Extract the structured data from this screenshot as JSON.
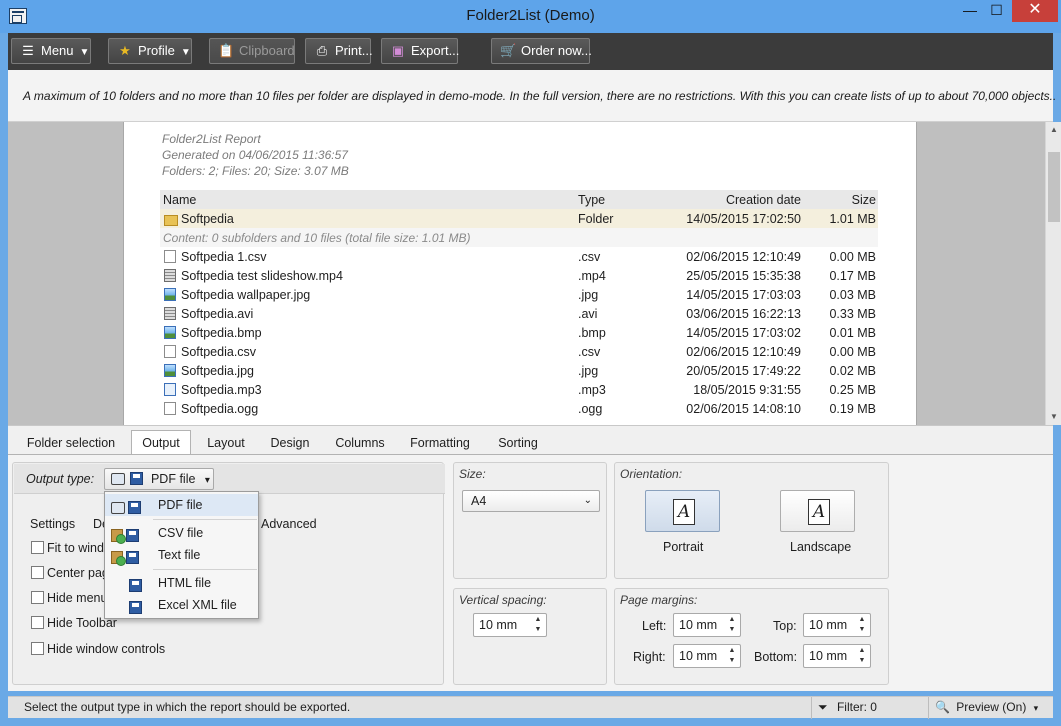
{
  "window": {
    "title": "Folder2List (Demo)",
    "minimize": "—",
    "maximize": "☐",
    "close": "✕"
  },
  "toolbar": {
    "menu": "Menu",
    "profile": "Profile",
    "clipboard": "Clipboard",
    "print": "Print...",
    "export": "Export...",
    "order": "Order now..."
  },
  "notice": "A maximum of 10 folders and no more than 10 files per folder are displayed in demo-mode. In the full version, there are no restrictions. With this you can create lists of up to about 70,000 objects..",
  "report": {
    "title": "Folder2List Report",
    "generated": "Generated on 04/06/2015 11:36:57",
    "summary": "Folders: 2;  Files: 20;  Size: 3.07 MB",
    "headers": {
      "name": "Name",
      "type": "Type",
      "date": "Creation date",
      "size": "Size"
    },
    "folder": {
      "icon": "folder-icon",
      "name": "Softpedia",
      "type": "Folder",
      "date": "14/05/2015 17:02:50",
      "size": "1.01 MB"
    },
    "folder_content": "Content: 0 subfolders and 10 files (total file size: 1.01 MB)",
    "files": [
      {
        "icon": "document-icon",
        "name": "Softpedia 1.csv",
        "type": ".csv",
        "date": "02/06/2015 12:10:49",
        "size": "0.00 MB"
      },
      {
        "icon": "video-file-icon",
        "name": "Softpedia test slideshow.mp4",
        "type": ".mp4",
        "date": "25/05/2015 15:35:38",
        "size": "0.17 MB"
      },
      {
        "icon": "image-file-icon",
        "name": "Softpedia wallpaper.jpg",
        "type": ".jpg",
        "date": "14/05/2015 17:03:03",
        "size": "0.03 MB"
      },
      {
        "icon": "video-file-icon",
        "name": "Softpedia.avi",
        "type": ".avi",
        "date": "03/06/2015 16:22:13",
        "size": "0.33 MB"
      },
      {
        "icon": "image-file-icon",
        "name": "Softpedia.bmp",
        "type": ".bmp",
        "date": "14/05/2015 17:03:02",
        "size": "0.01 MB"
      },
      {
        "icon": "document-icon",
        "name": "Softpedia.csv",
        "type": ".csv",
        "date": "02/06/2015 12:10:49",
        "size": "0.00 MB"
      },
      {
        "icon": "image-file-icon",
        "name": "Softpedia.jpg",
        "type": ".jpg",
        "date": "20/05/2015 17:49:22",
        "size": "0.02 MB"
      },
      {
        "icon": "audio-file-icon",
        "name": "Softpedia.mp3",
        "type": ".mp3",
        "date": "18/05/2015 9:31:55",
        "size": "0.25 MB"
      },
      {
        "icon": "document-icon",
        "name": "Softpedia.ogg",
        "type": ".ogg",
        "date": "02/06/2015 14:08:10",
        "size": "0.19 MB"
      }
    ]
  },
  "tabs": [
    "Folder selection",
    "Output",
    "Layout",
    "Design",
    "Columns",
    "Formatting",
    "Sorting"
  ],
  "output": {
    "type_label": "Output type:",
    "type_value": "PDF file",
    "settings_tab": "Settings",
    "design_tab_partial": "De",
    "advanced_tab": "Advanced",
    "checkboxes": [
      "Fit to wind",
      "Center pag",
      "Hide menu",
      "Hide Toolbar",
      "Hide window controls"
    ],
    "menu_items": [
      "PDF file",
      "CSV file",
      "Text file",
      "HTML file",
      "Excel XML file"
    ]
  },
  "size": {
    "label": "Size:",
    "value": "A4"
  },
  "orientation": {
    "label": "Orientation:",
    "portrait": "Portrait",
    "landscape": "Landscape",
    "glyph": "A",
    "selected": "Portrait"
  },
  "vertical_spacing": {
    "label": "Vertical spacing:",
    "value": "10 mm"
  },
  "margins": {
    "label": "Page margins:",
    "left_label": "Left:",
    "left": "10 mm",
    "top_label": "Top:",
    "top": "10 mm",
    "right_label": "Right:",
    "right": "10 mm",
    "bottom_label": "Bottom:",
    "bottom": "10 mm"
  },
  "status": {
    "message": "Select the output type in which the report should be exported.",
    "filter": "Filter: 0",
    "preview": "Preview (On)"
  }
}
